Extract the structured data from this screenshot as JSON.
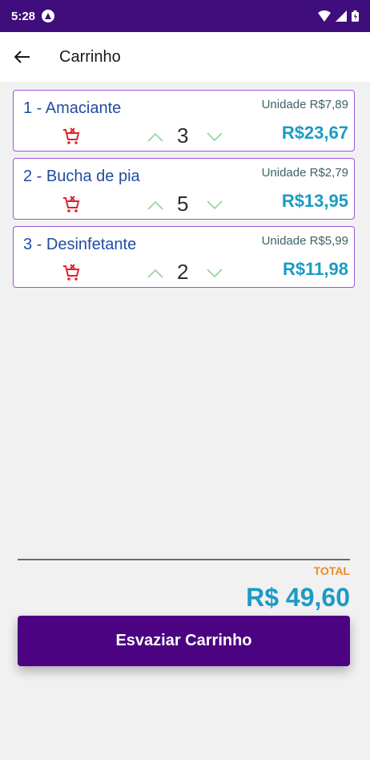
{
  "status_bar": {
    "time": "5:28"
  },
  "app_bar": {
    "title": "Carrinho"
  },
  "cart": {
    "items": [
      {
        "name": "1 - Amaciante",
        "unit_price": "Unidade R$7,89",
        "quantity": "3",
        "total": "R$23,67"
      },
      {
        "name": "2 - Bucha de pia",
        "unit_price": "Unidade R$2,79",
        "quantity": "5",
        "total": "R$13,95"
      },
      {
        "name": "3 - Desinfetante",
        "unit_price": "Unidade R$5,99",
        "quantity": "2",
        "total": "R$11,98"
      }
    ]
  },
  "summary": {
    "total_label": "TOTAL",
    "total_value": "R$ 49,60"
  },
  "actions": {
    "empty_cart_label": "Esvaziar Carrinho"
  },
  "colors": {
    "status_bar": "#3f0d7c",
    "primary_button": "#4b0382",
    "item_border": "#9c55d6",
    "item_name": "#1f4d9f",
    "price": "#1b9bc5",
    "total_label": "#f0891f",
    "remove_icon": "#e0202a",
    "qty_arrows": "#8fd49b"
  }
}
